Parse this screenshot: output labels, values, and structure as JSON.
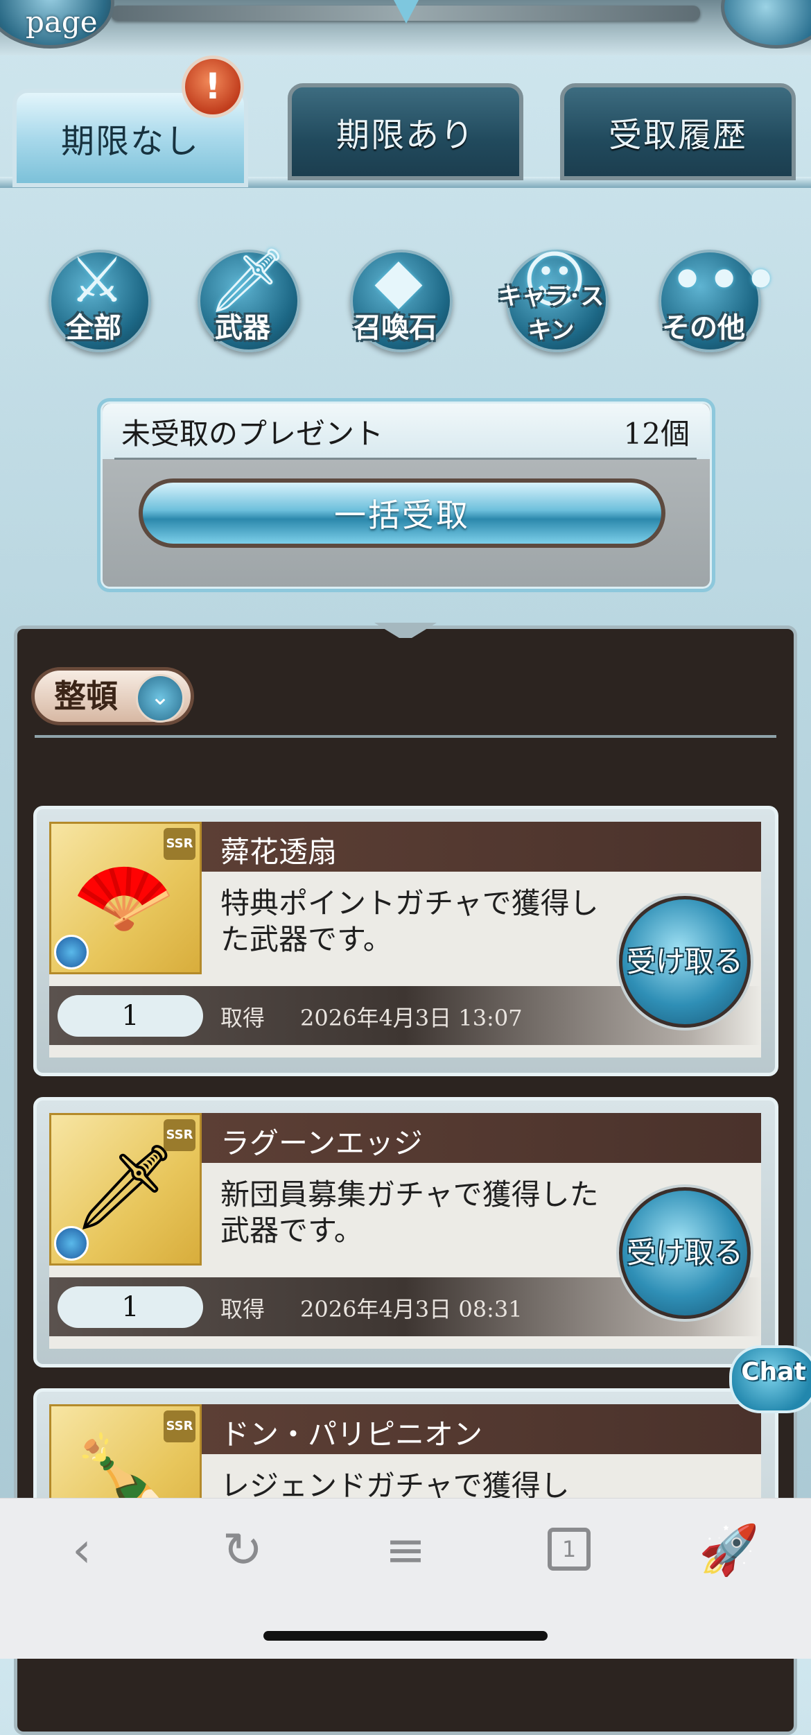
{
  "header": {
    "page_badge": "page"
  },
  "tabs": [
    {
      "label": "期限なし",
      "active": true
    },
    {
      "label": "期限あり",
      "active": false
    },
    {
      "label": "受取履歴",
      "active": false
    }
  ],
  "alert_badge": "!",
  "categories": [
    {
      "label": "全部",
      "icon": "all-items-icon"
    },
    {
      "label": "武器",
      "icon": "weapon-icon"
    },
    {
      "label": "召喚石",
      "icon": "summon-stone-icon"
    },
    {
      "label": "キャラ･スキン",
      "icon": "character-skin-icon"
    },
    {
      "label": "その他",
      "icon": "other-icon"
    }
  ],
  "summary": {
    "title": "未受取のプレゼント",
    "count": "12個",
    "bulk_button": "一括受取"
  },
  "sort_button": "整頓",
  "items": [
    {
      "name": "蕣花透扇",
      "description": "特典ポイントガチャで獲得した武器です。",
      "quantity": "1",
      "acquired_label": "取得",
      "acquired_date": "2026年4月3日 13:07",
      "receive_button": "受け取る",
      "rarity": "SSR"
    },
    {
      "name": "ラグーンエッジ",
      "description": "新団員募集ガチャで獲得した武器です。",
      "quantity": "1",
      "acquired_label": "取得",
      "acquired_date": "2026年4月3日 08:31",
      "receive_button": "受け取る",
      "rarity": "SSR"
    },
    {
      "name": "ドン・パリピニオン",
      "description": "レジェンドガチャで獲得し",
      "quantity": "",
      "acquired_label": "",
      "acquired_date": "",
      "receive_button": "",
      "rarity": "SSR"
    }
  ],
  "chat_button": "Chat",
  "toolbar": {
    "back": "back-icon",
    "reload": "reload-icon",
    "menu": "menu-icon",
    "tab_count": "1",
    "share": "rocket-icon"
  }
}
